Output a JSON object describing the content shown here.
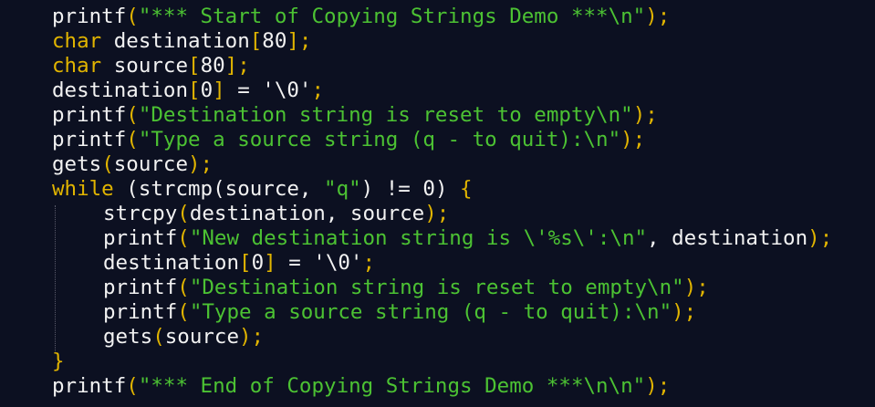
{
  "editor": {
    "theme": {
      "background": "#0c1021",
      "default": "#f2f2f2",
      "keyword": "#e1b400",
      "string": "#4cc233",
      "punct": "#e1b400"
    },
    "lines": [
      {
        "indent": 0,
        "tokens": [
          {
            "t": "printf",
            "k": "default"
          },
          {
            "t": "(",
            "k": "punct"
          },
          {
            "t": "\"*** Start of Copying Strings Demo ***\\n\"",
            "k": "string"
          },
          {
            "t": ");",
            "k": "punct"
          }
        ]
      },
      {
        "indent": 0,
        "tokens": [
          {
            "t": "char",
            "k": "keyword"
          },
          {
            "t": " destination",
            "k": "default"
          },
          {
            "t": "[",
            "k": "punct"
          },
          {
            "t": "80",
            "k": "default"
          },
          {
            "t": "];",
            "k": "punct"
          }
        ]
      },
      {
        "indent": 0,
        "tokens": [
          {
            "t": "char",
            "k": "keyword"
          },
          {
            "t": " source",
            "k": "default"
          },
          {
            "t": "[",
            "k": "punct"
          },
          {
            "t": "80",
            "k": "default"
          },
          {
            "t": "];",
            "k": "punct"
          }
        ]
      },
      {
        "indent": 0,
        "tokens": [
          {
            "t": "destination",
            "k": "default"
          },
          {
            "t": "[",
            "k": "punct"
          },
          {
            "t": "0",
            "k": "default"
          },
          {
            "t": "]",
            "k": "punct"
          },
          {
            "t": " = ",
            "k": "default"
          },
          {
            "t": "'\\0'",
            "k": "default"
          },
          {
            "t": ";",
            "k": "punct"
          }
        ]
      },
      {
        "indent": 0,
        "tokens": [
          {
            "t": "printf",
            "k": "default"
          },
          {
            "t": "(",
            "k": "punct"
          },
          {
            "t": "\"Destination string is reset to empty\\n\"",
            "k": "string"
          },
          {
            "t": ");",
            "k": "punct"
          }
        ]
      },
      {
        "indent": 0,
        "tokens": [
          {
            "t": "printf",
            "k": "default"
          },
          {
            "t": "(",
            "k": "punct"
          },
          {
            "t": "\"Type a source string (q - to quit):\\n\"",
            "k": "string"
          },
          {
            "t": ");",
            "k": "punct"
          }
        ]
      },
      {
        "indent": 0,
        "tokens": [
          {
            "t": "gets",
            "k": "default"
          },
          {
            "t": "(",
            "k": "punct"
          },
          {
            "t": "source",
            "k": "default"
          },
          {
            "t": ");",
            "k": "punct"
          }
        ]
      },
      {
        "indent": 0,
        "tokens": [
          {
            "t": "while",
            "k": "keyword"
          },
          {
            "t": " (strcmp(source, ",
            "k": "default"
          },
          {
            "t": "\"q\"",
            "k": "string"
          },
          {
            "t": ") != 0) ",
            "k": "default"
          },
          {
            "t": "{",
            "k": "punct"
          }
        ]
      },
      {
        "indent": 1,
        "tokens": [
          {
            "t": "strcpy",
            "k": "default"
          },
          {
            "t": "(",
            "k": "punct"
          },
          {
            "t": "destination, source",
            "k": "default"
          },
          {
            "t": ");",
            "k": "punct"
          }
        ]
      },
      {
        "indent": 1,
        "tokens": [
          {
            "t": "printf",
            "k": "default"
          },
          {
            "t": "(",
            "k": "punct"
          },
          {
            "t": "\"New destination string is \\'%s\\':\\n\"",
            "k": "string"
          },
          {
            "t": ", destination",
            "k": "default"
          },
          {
            "t": ");",
            "k": "punct"
          }
        ]
      },
      {
        "indent": 1,
        "tokens": [
          {
            "t": "destination",
            "k": "default"
          },
          {
            "t": "[",
            "k": "punct"
          },
          {
            "t": "0",
            "k": "default"
          },
          {
            "t": "]",
            "k": "punct"
          },
          {
            "t": " = ",
            "k": "default"
          },
          {
            "t": "'\\0'",
            "k": "default"
          },
          {
            "t": ";",
            "k": "punct"
          }
        ]
      },
      {
        "indent": 1,
        "tokens": [
          {
            "t": "printf",
            "k": "default"
          },
          {
            "t": "(",
            "k": "punct"
          },
          {
            "t": "\"Destination string is reset to empty\\n\"",
            "k": "string"
          },
          {
            "t": ");",
            "k": "punct"
          }
        ]
      },
      {
        "indent": 1,
        "tokens": [
          {
            "t": "printf",
            "k": "default"
          },
          {
            "t": "(",
            "k": "punct"
          },
          {
            "t": "\"Type a source string (q - to quit):\\n\"",
            "k": "string"
          },
          {
            "t": ");",
            "k": "punct"
          }
        ]
      },
      {
        "indent": 1,
        "tokens": [
          {
            "t": "gets",
            "k": "default"
          },
          {
            "t": "(",
            "k": "punct"
          },
          {
            "t": "source",
            "k": "default"
          },
          {
            "t": ");",
            "k": "punct"
          }
        ]
      },
      {
        "indent": 0,
        "tokens": [
          {
            "t": "}",
            "k": "punct"
          }
        ]
      },
      {
        "indent": 0,
        "tokens": [
          {
            "t": "printf",
            "k": "default"
          },
          {
            "t": "(",
            "k": "punct"
          },
          {
            "t": "\"*** End of Copying Strings Demo ***\\n\\n\"",
            "k": "string"
          },
          {
            "t": ");",
            "k": "punct"
          }
        ]
      }
    ]
  }
}
